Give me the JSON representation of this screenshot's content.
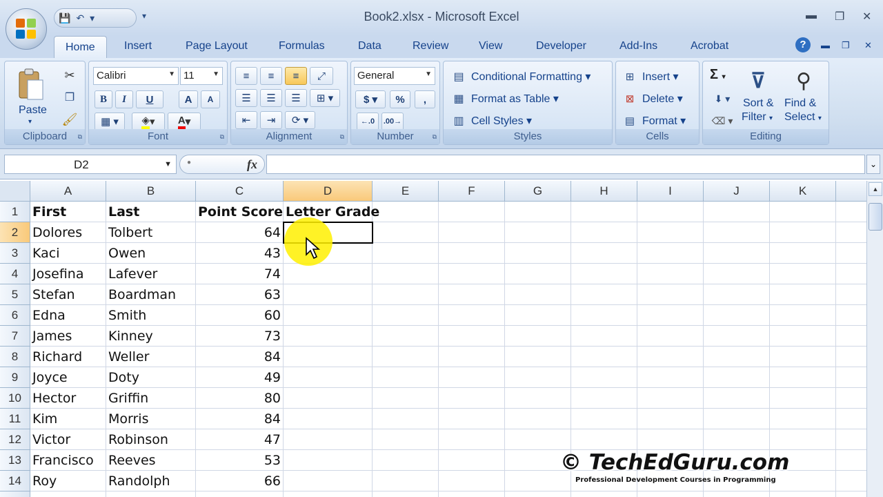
{
  "window": {
    "title": "Book2.xlsx - Microsoft Excel",
    "minimize": "▬",
    "restore": "❐",
    "close": "✕"
  },
  "qat": {
    "save": "💾",
    "undo": "↶",
    "more": "▾"
  },
  "tabs": [
    "Home",
    "Insert",
    "Page Layout",
    "Formulas",
    "Data",
    "Review",
    "View",
    "Developer",
    "Add-Ins",
    "Acrobat"
  ],
  "ribbon": {
    "clipboard": {
      "label": "Clipboard",
      "paste": "Paste"
    },
    "font": {
      "label": "Font",
      "name": "Calibri",
      "size": "11",
      "bold": "B",
      "italic": "I",
      "underline": "U",
      "grow": "A",
      "shrink": "A"
    },
    "alignment": {
      "label": "Alignment"
    },
    "number": {
      "label": "Number",
      "format": "General",
      "currency": "$",
      "percent": "%",
      "comma": ","
    },
    "styles": {
      "label": "Styles",
      "conditional": "Conditional Formatting",
      "table": "Format as Table",
      "cell": "Cell Styles"
    },
    "cells": {
      "label": "Cells",
      "insert": "Insert",
      "delete": "Delete",
      "format": "Format"
    },
    "editing": {
      "label": "Editing",
      "sort": "Sort &",
      "filter": "Filter",
      "find": "Find &",
      "select": "Select",
      "sigma": "Σ"
    }
  },
  "formula_bar": {
    "name_box": "D2",
    "fx": "fx",
    "value": ""
  },
  "columns": [
    "A",
    "B",
    "C",
    "D",
    "E",
    "F",
    "G",
    "H",
    "I",
    "J",
    "K"
  ],
  "rows": [
    {
      "n": "1",
      "a": "First",
      "b": "Last",
      "c": "Point Score",
      "d": "Letter Grade"
    },
    {
      "n": "2",
      "a": "Dolores",
      "b": "Tolbert",
      "c": "64",
      "d": ""
    },
    {
      "n": "3",
      "a": "Kaci",
      "b": "Owen",
      "c": "43",
      "d": ""
    },
    {
      "n": "4",
      "a": "Josefina",
      "b": "Lafever",
      "c": "74",
      "d": ""
    },
    {
      "n": "5",
      "a": "Stefan",
      "b": "Boardman",
      "c": "63",
      "d": ""
    },
    {
      "n": "6",
      "a": "Edna",
      "b": "Smith",
      "c": "60",
      "d": ""
    },
    {
      "n": "7",
      "a": "James",
      "b": "Kinney",
      "c": "73",
      "d": ""
    },
    {
      "n": "8",
      "a": "Richard",
      "b": "Weller",
      "c": "84",
      "d": ""
    },
    {
      "n": "9",
      "a": "Joyce",
      "b": "Doty",
      "c": "49",
      "d": ""
    },
    {
      "n": "10",
      "a": "Hector",
      "b": "Griffin",
      "c": "80",
      "d": ""
    },
    {
      "n": "11",
      "a": "Kim",
      "b": "Morris",
      "c": "84",
      "d": ""
    },
    {
      "n": "12",
      "a": "Victor",
      "b": "Robinson",
      "c": "47",
      "d": ""
    },
    {
      "n": "13",
      "a": "Francisco",
      "b": "Reeves",
      "c": "53",
      "d": ""
    },
    {
      "n": "14",
      "a": "Roy",
      "b": "Randolph",
      "c": "66",
      "d": ""
    }
  ],
  "watermark": {
    "text": "© TechEdGuru.com",
    "sub": "Professional Development Courses in Programming"
  },
  "colors": {
    "accent": "#15428b",
    "selection": "#f9c97a",
    "highlight": "#fff000"
  }
}
